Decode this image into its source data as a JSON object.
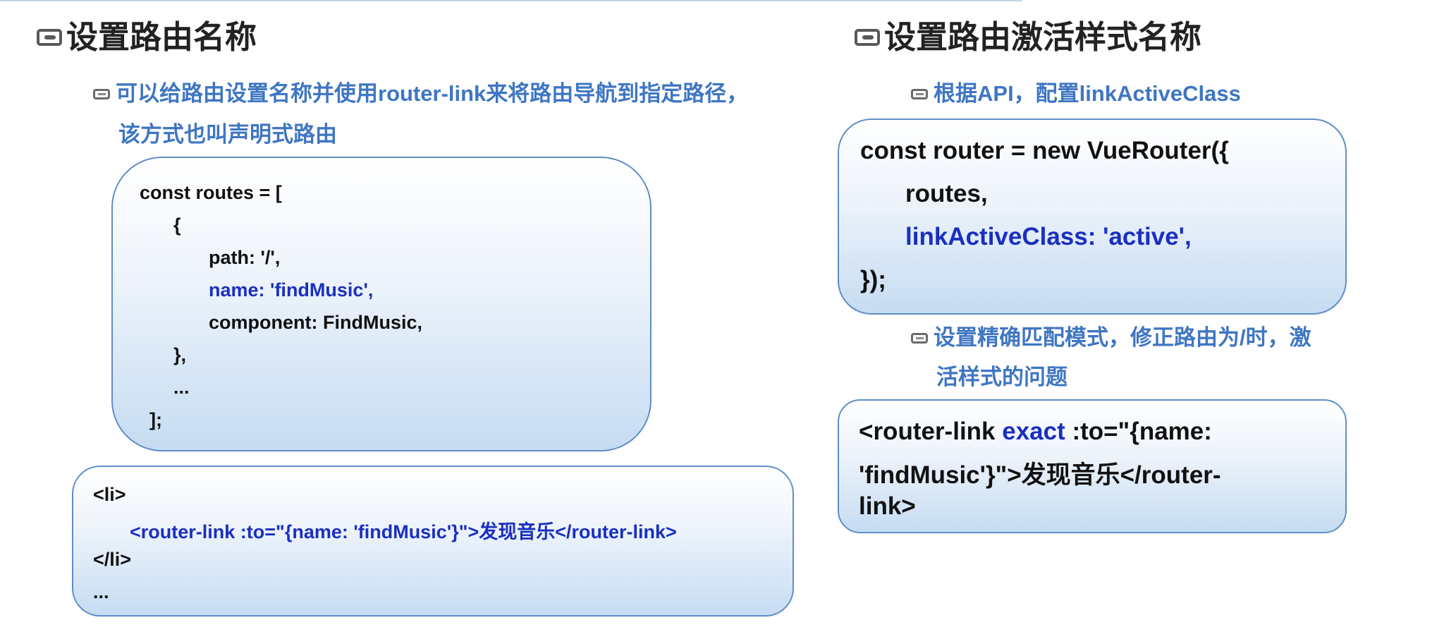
{
  "left_section": {
    "title": "设置路由名称",
    "bullet_line1": "可以给路由设置名称并使用router-link来将路由导航到指定路径，",
    "bullet_line2": "该方式也叫声明式路由",
    "routes_code": [
      "const routes = [",
      "{",
      "path: '/',",
      "name: 'findMusic',",
      "component: FindMusic,",
      "},",
      "...",
      "];"
    ],
    "li_code": [
      "<li>",
      "<router-link :to=\"{name: 'findMusic'}\">发现音乐</router-link>",
      "</li>",
      "..."
    ]
  },
  "right_section": {
    "title": "设置路由激活样式名称",
    "bullet1": "根据API，配置linkActiveClass",
    "router_code": [
      "const router = new VueRouter({",
      "routes,",
      "linkActiveClass: 'active',",
      "});"
    ],
    "bullet2_line1": "设置精确匹配模式，修正路由为/时，激",
    "bullet2_line2": "活样式的问题",
    "exact_code": {
      "l1_pre": "<router-link ",
      "l1_blue": "exact",
      "l1_post": " :to=\"{name:",
      "l2": "'findMusic'}\">发现音乐</router-",
      "l3": "link>"
    }
  },
  "colors": {
    "accent_blue": "#3f76c2",
    "code_blue": "#1a2fc0",
    "border": "#5f8dc7"
  }
}
